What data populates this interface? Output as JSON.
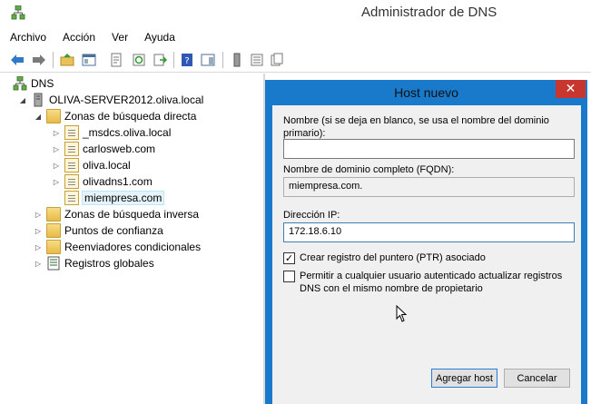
{
  "window": {
    "title": "Administrador de DNS"
  },
  "menu": [
    "Archivo",
    "Acción",
    "Ver",
    "Ayuda"
  ],
  "tree": {
    "root": "DNS",
    "server": "OLIVA-SERVER2012.oliva.local",
    "forward_zones": "Zonas de búsqueda directa",
    "zones": [
      "_msdcs.oliva.local",
      "carlosweb.com",
      "oliva.local",
      "olivadns1.com",
      "miempresa.com"
    ],
    "reverse_zones": "Zonas de búsqueda inversa",
    "trust_points": "Puntos de confianza",
    "conditional_forwarders": "Reenviadores condicionales",
    "global_logs": "Registros globales"
  },
  "dialog": {
    "title": "Host nuevo",
    "close": "✕",
    "name_label": "Nombre (si se deja en blanco, se usa el nombre del dominio primario):",
    "name_value": "",
    "fqdn_label": "Nombre de dominio completo (FQDN):",
    "fqdn_value": "miempresa.com.",
    "ip_label": "Dirección IP:",
    "ip_value": "172.18.6.10",
    "ptr_label": "Crear registro del puntero (PTR) asociado",
    "ptr_checked": "✓",
    "auth_label": "Permitir a cualquier usuario autenticado actualizar registros DNS con el mismo nombre de propietario",
    "add_button": "Agregar host",
    "cancel_button": "Cancelar"
  }
}
